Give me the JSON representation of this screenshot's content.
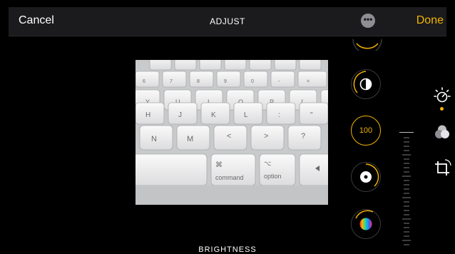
{
  "header": {
    "cancel_label": "Cancel",
    "title": "ADJUST",
    "done_label": "Done",
    "more_icon": "ellipsis-icon"
  },
  "photo": {
    "keys_row1": [
      "Y",
      "U",
      "I",
      "O",
      "P",
      "{",
      "}"
    ],
    "keys_row1_sub": [
      "6",
      "7",
      "8",
      "9",
      "0",
      "-",
      "="
    ],
    "keys_row2": [
      "H",
      "J",
      "K",
      "L",
      ":",
      "\""
    ],
    "keys_row3": [
      "N",
      "M",
      "<",
      ">",
      "?"
    ],
    "command_symbol": "⌘",
    "command_label": "command",
    "option_symbol": "⌥",
    "option_label": "option"
  },
  "adjustments": {
    "active_label": "BRIGHTNESS",
    "active_value": "100",
    "dials": [
      "auto-icon",
      "contrast-icon",
      "brightness-dial",
      "black-point-icon",
      "color-wheel-icon"
    ]
  },
  "tools": [
    "adjust-tool-icon",
    "filters-tool-icon",
    "crop-tool-icon"
  ],
  "colors": {
    "accent": "#f2b300",
    "topbar": "#1b1b1d",
    "background": "#000000"
  }
}
